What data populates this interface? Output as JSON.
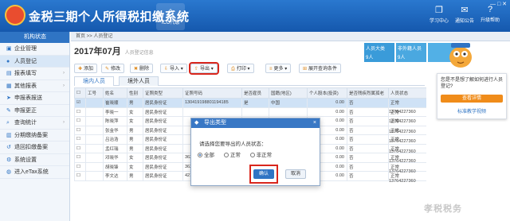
{
  "header": {
    "title": "金税三期个人所得税扣缴系统",
    "home_label": "ICO代缴",
    "tools": [
      {
        "label": "学习中心",
        "icon": "book-icon"
      },
      {
        "label": "通知公告",
        "icon": "bell-icon"
      },
      {
        "label": "升级帮助",
        "icon": "help-icon"
      }
    ]
  },
  "sidebar": {
    "head": "机构状态",
    "items": [
      {
        "label": "企业管理",
        "icon": "building-icon"
      },
      {
        "label": "人员登记",
        "icon": "person-icon"
      },
      {
        "label": "报表填写",
        "icon": "form-icon"
      },
      {
        "label": "其他报表",
        "icon": "report-icon"
      },
      {
        "label": "申报表报送",
        "icon": "send-icon"
      },
      {
        "label": "申报更正",
        "icon": "edit-icon"
      },
      {
        "label": "查询统计",
        "icon": "search-icon"
      },
      {
        "label": "分期缴纳备案",
        "icon": "calendar-icon"
      },
      {
        "label": "退回扣缴备案",
        "icon": "return-icon"
      },
      {
        "label": "系统设置",
        "icon": "gear-icon"
      },
      {
        "label": "进入eTax系统",
        "icon": "globe-icon"
      }
    ]
  },
  "main": {
    "breadcrumb": "首页 >> 人员登记",
    "period": "2017年07月",
    "period_sub": "人员登记信息",
    "toolbar": {
      "add": "添加",
      "modify": "修改",
      "delete": "删除",
      "import": "导入",
      "export": "导出",
      "print": "打印",
      "more": "更多",
      "expand": "展开查询条件"
    },
    "tabs": [
      "境内人员",
      "境外人员"
    ],
    "table": {
      "headers": [
        "",
        "工号",
        "姓名",
        "性别",
        "证照类型",
        "证照号码",
        "是否雇员",
        "国籍(地区)",
        "个人股本(投资)",
        "是否残疾烈属孤老",
        "人员状态"
      ],
      "rows": [
        {
          "name": "崔晓顺",
          "gender": "男",
          "id_type": "居民身份证",
          "id_no": "130419198801194185",
          "emp": "是",
          "nation": "中国",
          "amount": "0.00",
          "special": "否",
          "status": "正常",
          "phone": ""
        },
        {
          "name": "李晓一",
          "gender": "女",
          "id_type": "居民身份证",
          "id_no": "",
          "emp": "",
          "nation": "",
          "amount": "0.00",
          "special": "否",
          "status": "正常",
          "phone": "13764227360"
        },
        {
          "name": "陈晓萍",
          "gender": "女",
          "id_type": "居民身份证",
          "id_no": "",
          "emp": "",
          "nation": "",
          "amount": "0.00",
          "special": "否",
          "status": "正常",
          "phone": "13764227360"
        },
        {
          "name": "张金华",
          "gender": "男",
          "id_type": "居民身份证",
          "id_no": "",
          "emp": "",
          "nation": "",
          "amount": "0.00",
          "special": "否",
          "status": "正常",
          "phone": "13764227360"
        },
        {
          "name": "吕治浩",
          "gender": "男",
          "id_type": "居民身份证",
          "id_no": "",
          "emp": "",
          "nation": "",
          "amount": "0.00",
          "special": "否",
          "status": "正常",
          "phone": "13764227360"
        },
        {
          "name": "孟红瑞",
          "gender": "男",
          "id_type": "居民身份证",
          "id_no": "",
          "emp": "",
          "nation": "",
          "amount": "0.00",
          "special": "否",
          "status": "正常",
          "phone": "13764227360"
        },
        {
          "name": "邓晓华",
          "gender": "女",
          "id_type": "居民身份证",
          "id_no": "362531199901180125",
          "emp": "是",
          "nation": "中国",
          "amount": "0.00",
          "special": "否",
          "status": "正常",
          "phone": "13764227360"
        },
        {
          "name": "胡晓锋",
          "gender": "女",
          "id_type": "居民身份证",
          "id_no": "362531199901304527",
          "emp": "是",
          "nation": "中国",
          "amount": "0.00",
          "special": "否",
          "status": "正常",
          "phone": "13764227360"
        },
        {
          "name": "李文达",
          "gender": "男",
          "id_type": "居民身份证",
          "id_no": "421126199000208115",
          "emp": "是",
          "nation": "中国",
          "amount": "0.00",
          "special": "否",
          "status": "正常",
          "phone": "13764227360"
        }
      ]
    },
    "tiles": [
      {
        "label": "人员大类",
        "value": "9人"
      },
      {
        "label": "非外籍人员",
        "value": "9人"
      },
      {
        "label": "",
        "value": ""
      }
    ]
  },
  "help": {
    "question": "您是不是想了解如何进行人员登记?",
    "button": "查看详情",
    "link": "标准教学视频"
  },
  "modal": {
    "title": "导出类型",
    "prompt": "请选择您要导出的人员状态：",
    "options": [
      "全部",
      "正常",
      "非正常"
    ],
    "selected": "全部",
    "ok": "确认",
    "cancel": "取消",
    "close": "×"
  },
  "watermark": "孝税税务",
  "colors": {
    "header_blue": "#1f6bc3",
    "accent_orange": "#f08c1a",
    "highlight_red": "#d9261c"
  }
}
